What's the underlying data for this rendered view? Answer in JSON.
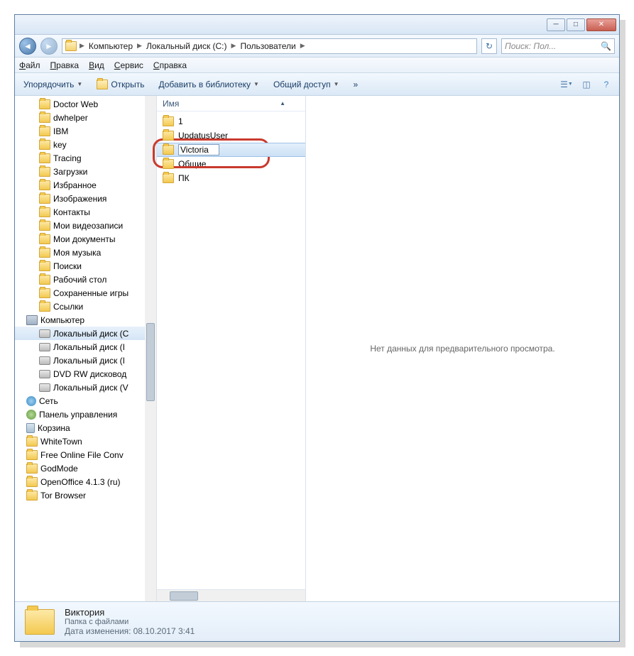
{
  "breadcrumb": {
    "seg1": "Компьютер",
    "seg2": "Локальный диск (C:)",
    "seg3": "Пользователи"
  },
  "search": {
    "placeholder": "Поиск: Пол..."
  },
  "menu": {
    "file": "Файл",
    "edit": "Правка",
    "view": "Вид",
    "service": "Сервис",
    "help": "Справка"
  },
  "toolbar": {
    "organize": "Упорядочить",
    "open": "Открыть",
    "addlib": "Добавить в библиотеку",
    "share": "Общий доступ",
    "overflow": "»"
  },
  "tree": {
    "items": [
      {
        "l": 2,
        "icon": "f",
        "label": "Doctor Web"
      },
      {
        "l": 2,
        "icon": "f",
        "label": "dwhelper"
      },
      {
        "l": 2,
        "icon": "f",
        "label": "IBM"
      },
      {
        "l": 2,
        "icon": "f",
        "label": "key"
      },
      {
        "l": 2,
        "icon": "f",
        "label": "Tracing"
      },
      {
        "l": 2,
        "icon": "f",
        "label": "Загрузки"
      },
      {
        "l": 2,
        "icon": "f",
        "label": "Избранное"
      },
      {
        "l": 2,
        "icon": "f",
        "label": "Изображения"
      },
      {
        "l": 2,
        "icon": "f",
        "label": "Контакты"
      },
      {
        "l": 2,
        "icon": "f",
        "label": "Мои видеозаписи"
      },
      {
        "l": 2,
        "icon": "f",
        "label": "Мои документы"
      },
      {
        "l": 2,
        "icon": "f",
        "label": "Моя музыка"
      },
      {
        "l": 2,
        "icon": "f",
        "label": "Поиски"
      },
      {
        "l": 2,
        "icon": "f",
        "label": "Рабочий стол"
      },
      {
        "l": 2,
        "icon": "f",
        "label": "Сохраненные игры"
      },
      {
        "l": 2,
        "icon": "f",
        "label": "Ссылки"
      },
      {
        "l": 1,
        "icon": "c",
        "label": "Компьютер"
      },
      {
        "l": 2,
        "icon": "d",
        "label": "Локальный диск (C",
        "sel": true
      },
      {
        "l": 2,
        "icon": "d",
        "label": "Локальный диск (I"
      },
      {
        "l": 2,
        "icon": "d",
        "label": "Локальный диск (I"
      },
      {
        "l": 2,
        "icon": "d",
        "label": "DVD RW дисковод"
      },
      {
        "l": 2,
        "icon": "d",
        "label": "Локальный диск (V"
      },
      {
        "l": 1,
        "icon": "n",
        "label": "Сеть"
      },
      {
        "l": 1,
        "icon": "p",
        "label": "Панель управления"
      },
      {
        "l": 1,
        "icon": "b",
        "label": "Корзина"
      },
      {
        "l": 1,
        "icon": "f",
        "label": "WhiteTown"
      },
      {
        "l": 1,
        "icon": "f",
        "label": "Free Online File Conv"
      },
      {
        "l": 1,
        "icon": "f",
        "label": "GodMode"
      },
      {
        "l": 1,
        "icon": "f",
        "label": "OpenOffice 4.1.3 (ru)"
      },
      {
        "l": 1,
        "icon": "f",
        "label": "Tor Browser"
      }
    ]
  },
  "list": {
    "header": "Имя",
    "items": [
      {
        "label": "1"
      },
      {
        "label": "UpdatusUser"
      },
      {
        "label": "Victoria",
        "rename": true,
        "sel": true
      },
      {
        "label": "Общие"
      },
      {
        "label": "ПК"
      }
    ]
  },
  "preview": {
    "empty": "Нет данных для предварительного просмотра."
  },
  "status": {
    "name": "Виктория",
    "type": "Папка с файлами",
    "date_label": "Дата изменения:",
    "date_value": "08.10.2017 3:41"
  }
}
